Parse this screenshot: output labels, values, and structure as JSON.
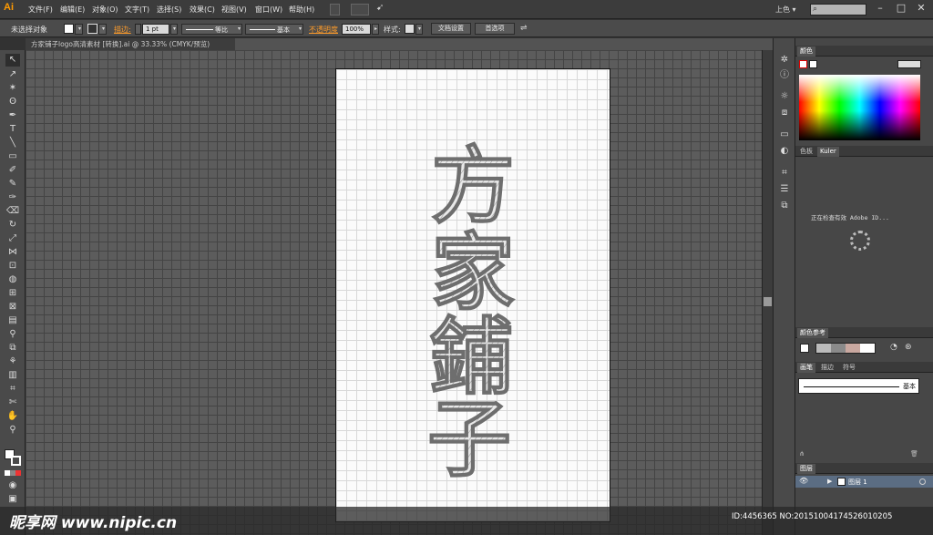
{
  "app": {
    "logo_text": "Ai"
  },
  "menu": [
    "文件(F)",
    "编辑(E)",
    "对象(O)",
    "文字(T)",
    "选择(S)",
    "效果(C)",
    "视图(V)",
    "窗口(W)",
    "帮助(H)"
  ],
  "workspace": {
    "label": "上色 ▾"
  },
  "window_controls": {
    "minimize": "–",
    "maximize": "□",
    "close": "✕"
  },
  "control_bar": {
    "selection_status": "未选择对象",
    "stroke_label": "描边:",
    "stroke_value": "1 pt",
    "profile_label": "等比",
    "brush_label": "基本",
    "opacity_label": "不透明度",
    "opacity_value": "100%",
    "style_label": "样式:",
    "doc_setup_button": "文档设置",
    "preferences_button": "首选项"
  },
  "document_tab": {
    "title": "方家铺子logo高清素材 [转换].ai @ 33.33% (CMYK/预览)"
  },
  "artwork": {
    "characters": [
      "方",
      "家",
      "鋪",
      "子"
    ]
  },
  "panels": {
    "color": {
      "tab": "颜色"
    },
    "color_guide_tabs": [
      "色板",
      "Kuler"
    ],
    "kuler_message": "正在检查有效 Adobe ID...",
    "color_reference": {
      "tab": "颜色参考"
    },
    "brushes": {
      "tabs": [
        "画笔",
        "描边",
        "符号"
      ],
      "brush_name": "基本"
    },
    "layers": {
      "tab": "图层",
      "layer_name": "图层 1"
    }
  },
  "watermark": {
    "logo": "昵享网 www.nipic.cn",
    "id_text": "ID:4456365 NO:20151004174526010205"
  },
  "colors": {
    "accent_orange": "#ff9a00",
    "canvas": "#5c5c5c",
    "layer_highlight": "#5b6d83"
  }
}
